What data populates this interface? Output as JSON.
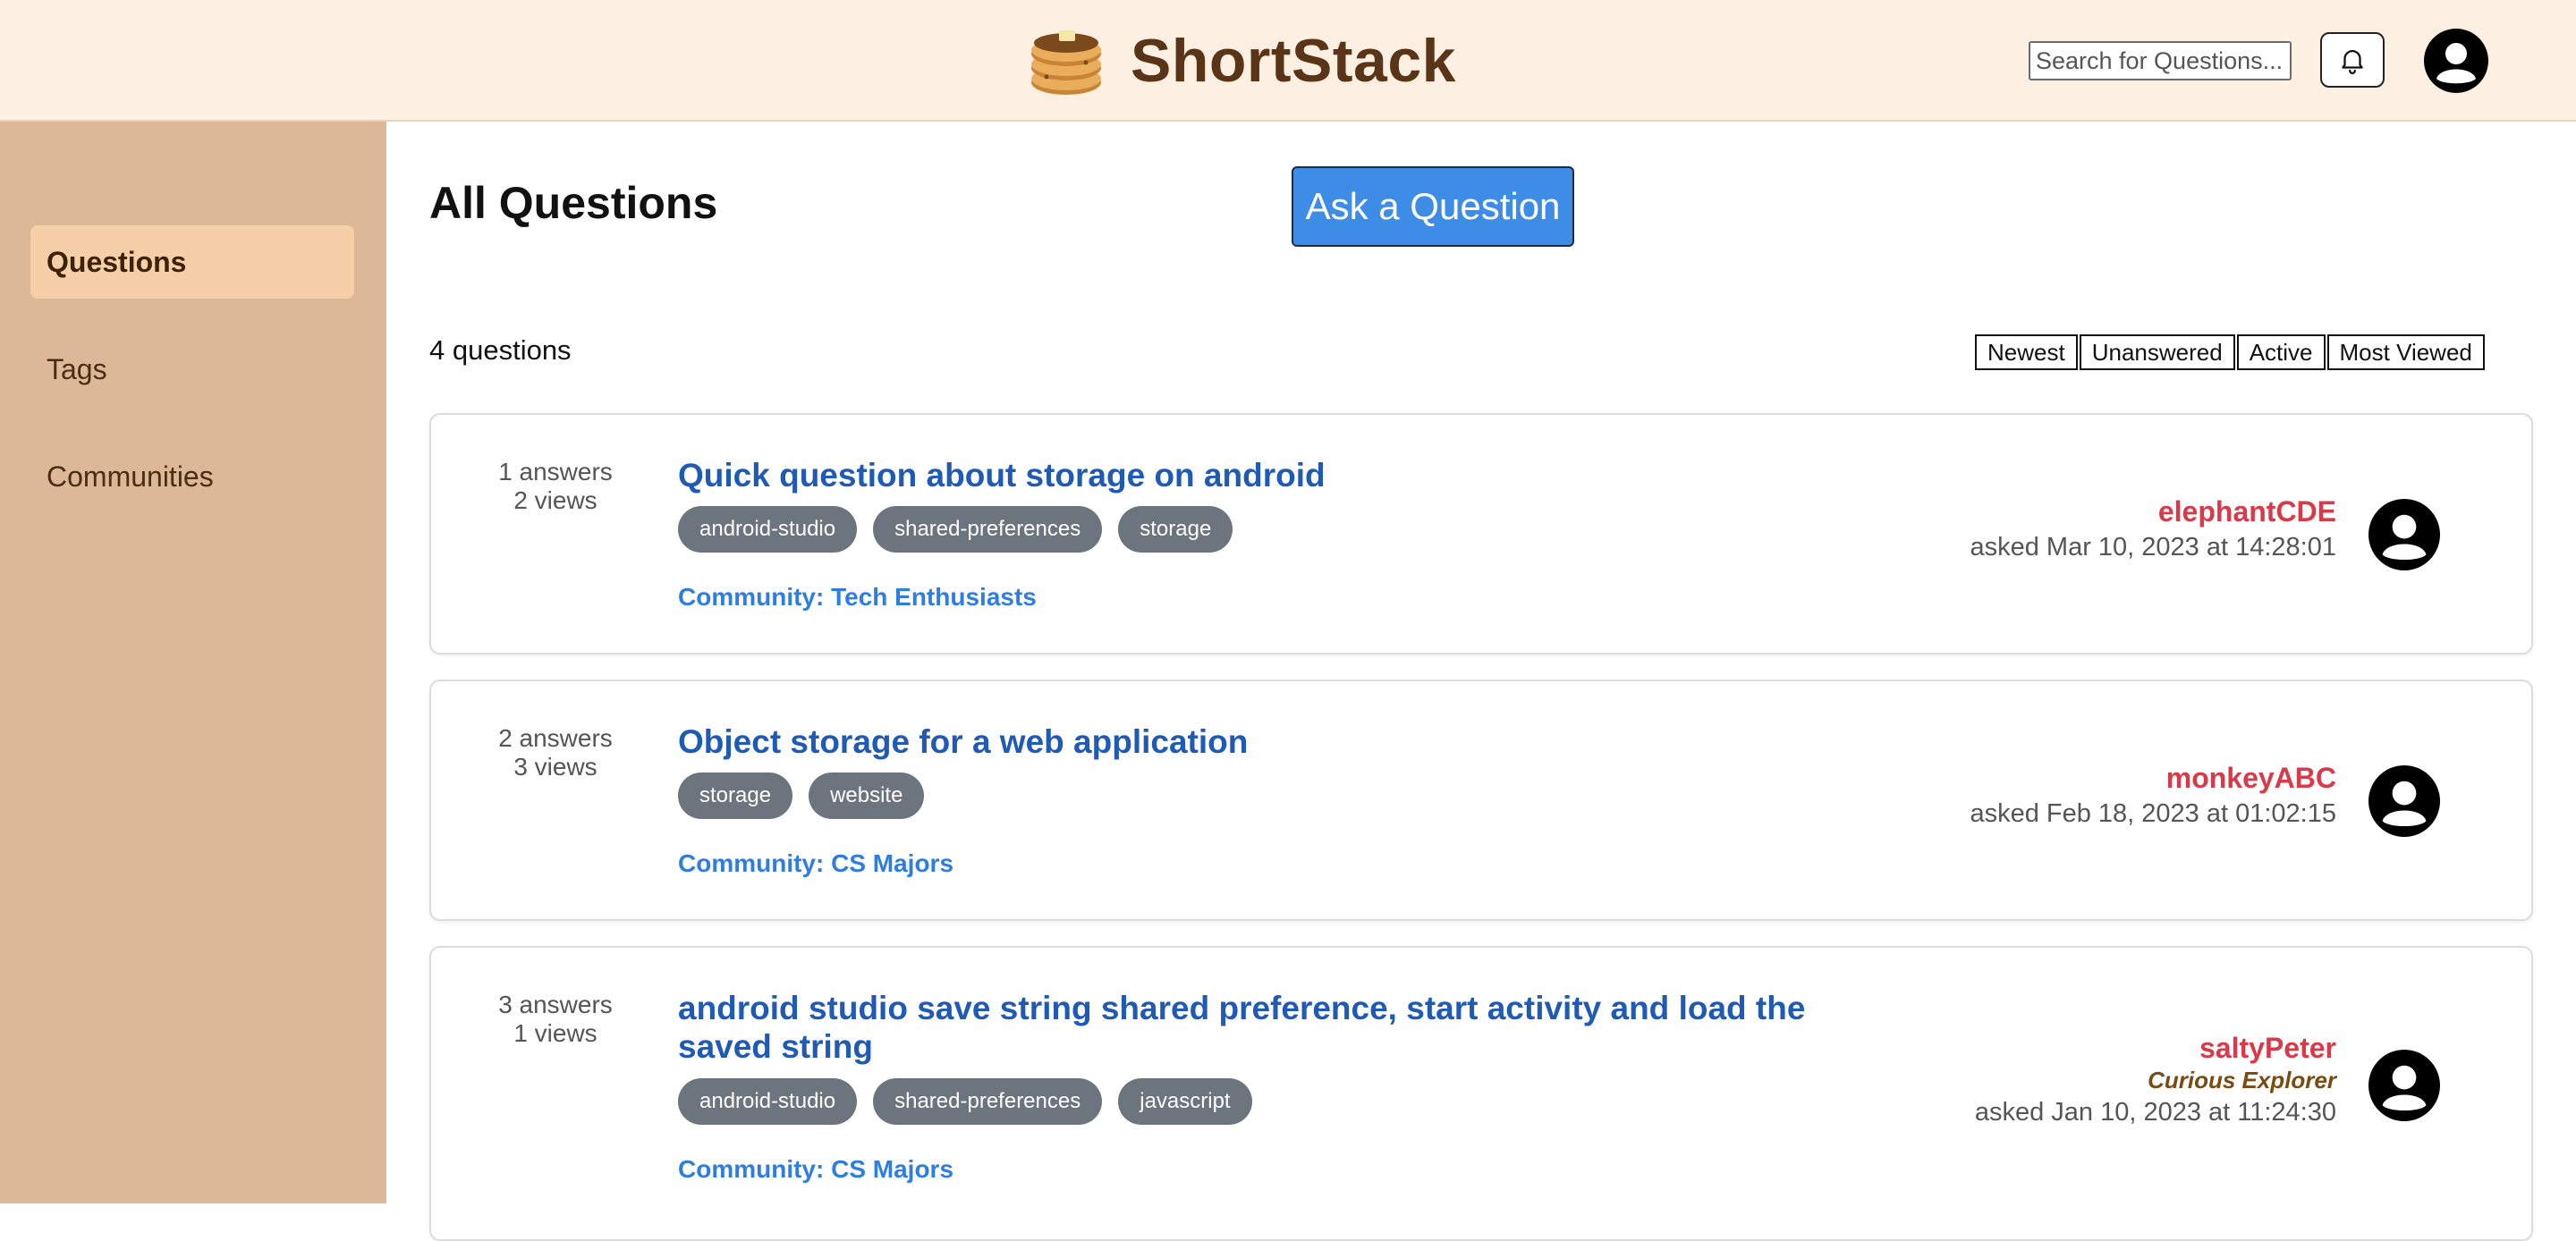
{
  "header": {
    "app_title": "ShortStack",
    "logo_icon": "pancake-stack-icon",
    "search_placeholder": "Search for Questions...",
    "bell_icon": "bell-icon",
    "avatar_icon": "user-avatar-icon"
  },
  "sidebar": {
    "items": [
      {
        "label": "Questions",
        "active": true
      },
      {
        "label": "Tags",
        "active": false
      },
      {
        "label": "Communities",
        "active": false
      }
    ]
  },
  "main": {
    "title": "All Questions",
    "ask_button": "Ask a Question",
    "count_label": "4 questions",
    "sort_buttons": [
      "Newest",
      "Unanswered",
      "Active",
      "Most Viewed"
    ]
  },
  "questions": [
    {
      "answers": "1 answers",
      "views": "2 views",
      "title": "Quick question about storage on android",
      "tags": [
        "android-studio",
        "shared-preferences",
        "storage"
      ],
      "community": "Community: Tech Enthusiasts",
      "author": "elephantCDE",
      "badge": "",
      "asked": "asked Mar 10, 2023 at 14:28:01"
    },
    {
      "answers": "2 answers",
      "views": "3 views",
      "title": "Object storage for a web application",
      "tags": [
        "storage",
        "website"
      ],
      "community": "Community: CS Majors",
      "author": "monkeyABC",
      "badge": "",
      "asked": "asked Feb 18, 2023 at 01:02:15"
    },
    {
      "answers": "3 answers",
      "views": "1 views",
      "title": "android studio save string shared preference, start activity and load the saved string",
      "tags": [
        "android-studio",
        "shared-preferences",
        "javascript"
      ],
      "community": "Community: CS Majors",
      "author": "saltyPeter",
      "badge": "Curious Explorer",
      "asked": "asked Jan 10, 2023 at 11:24:30"
    }
  ],
  "colors": {
    "header_bg": "#fdefe2",
    "sidebar_bg": "#ddb896",
    "sidebar_active": "#f5cfa8",
    "brand": "#5a3417",
    "accent_button": "#3d8de6",
    "question_title": "#1f5bb5",
    "community_link": "#2f7de1",
    "author": "#d83a4a",
    "tag_bg": "#6c757d"
  }
}
